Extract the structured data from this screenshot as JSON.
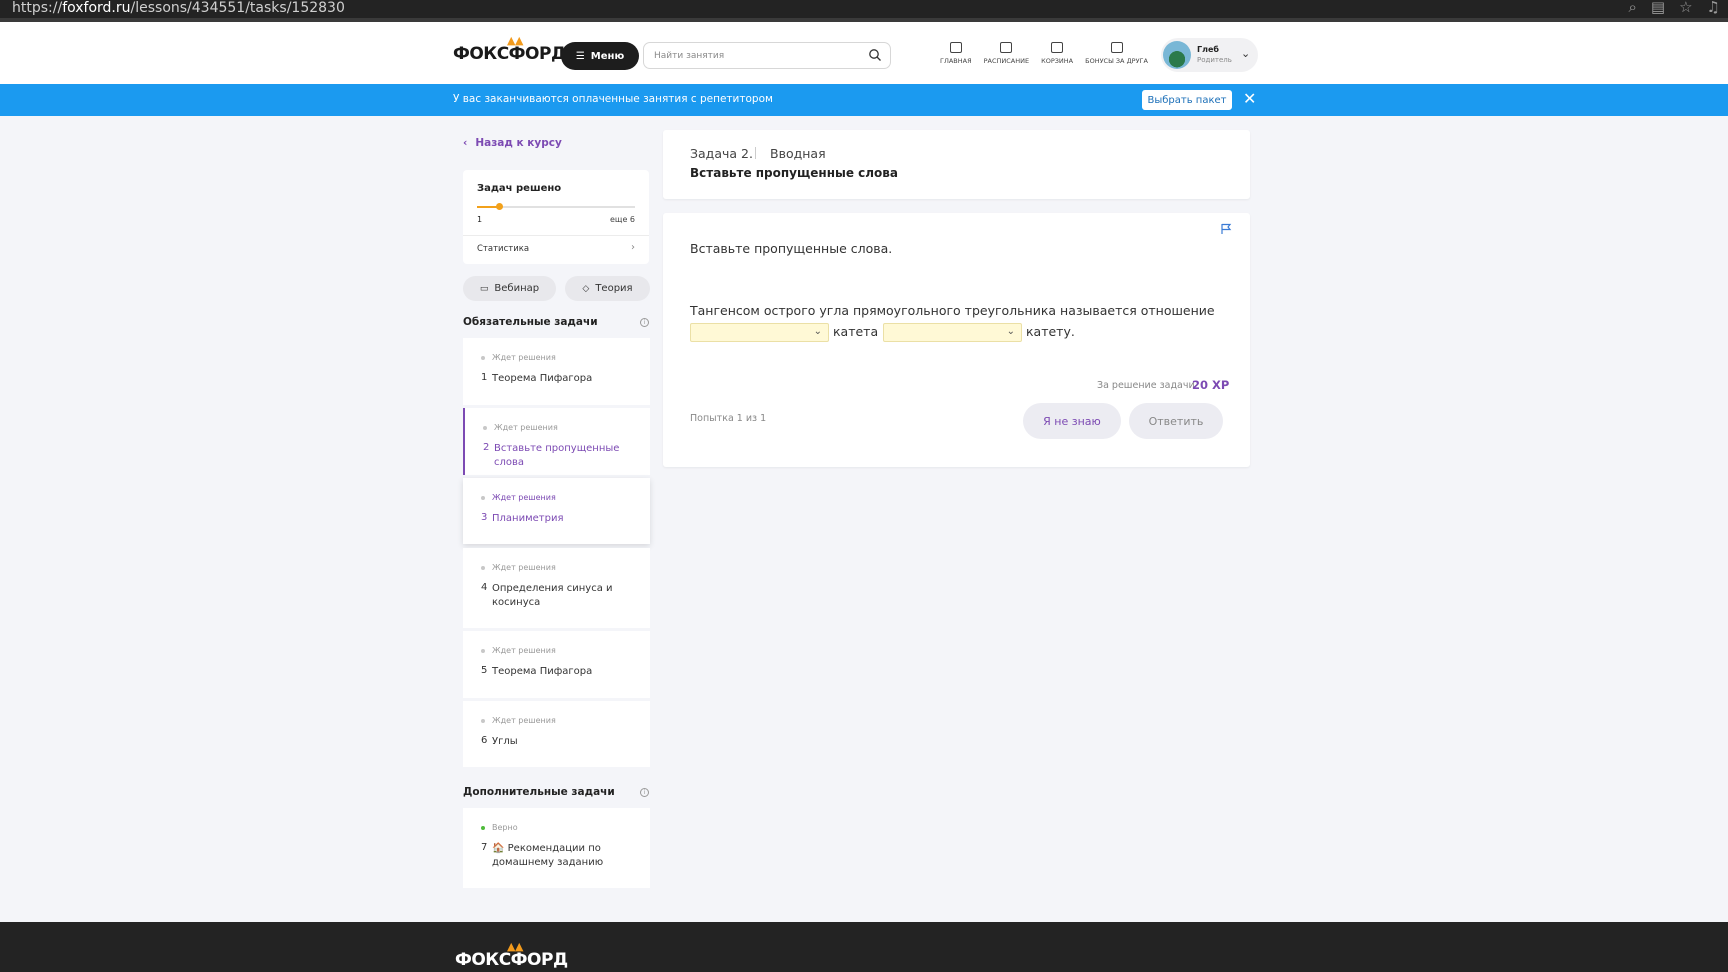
{
  "browser": {
    "url_prefix": "https://",
    "url_domain": "foxford.ru",
    "url_path": "/lessons/434551/tasks/152830"
  },
  "header": {
    "logo_text": "ФОКСФОРД",
    "menu_label": "Меню",
    "search_placeholder": "Найти занятия",
    "nav": [
      {
        "label": "ГЛАВНАЯ",
        "icon": "home-icon"
      },
      {
        "label": "РАСПИСАНИЕ",
        "icon": "calendar-icon"
      },
      {
        "label": "КОРЗИНА",
        "icon": "cart-icon"
      },
      {
        "label": "БОНУСЫ ЗА ДРУГА",
        "icon": "gift-icon"
      }
    ],
    "user": {
      "name": "Глеб",
      "role": "Родитель"
    }
  },
  "banner": {
    "text": "У вас заканчиваются оплаченные занятия с репетитором",
    "button": "Выбрать пакет"
  },
  "sidebar": {
    "back_label": "Назад к курсу",
    "progress": {
      "title": "Задач решено",
      "solved": "1",
      "remaining": "еще 6",
      "fraction": 0.14,
      "stats_label": "Статистика"
    },
    "webinar_label": "Вебинар",
    "theory_label": "Теория",
    "required_title": "Обязательные задачи",
    "required_tasks": [
      {
        "num": "1",
        "status": "Ждет решения",
        "label": "Теорема Пифагора"
      },
      {
        "num": "2",
        "status": "Ждет решения",
        "label": "Вставьте пропущенные слова"
      },
      {
        "num": "3",
        "status": "Ждет решения",
        "label": "Планиметрия"
      },
      {
        "num": "4",
        "status": "Ждет решения",
        "label": "Определения синуса и косинуса"
      },
      {
        "num": "5",
        "status": "Ждет решения",
        "label": "Теорема Пифагора"
      },
      {
        "num": "6",
        "status": "Ждет решения",
        "label": "Углы"
      }
    ],
    "extra_title": "Дополнительные задачи",
    "extra_tasks": [
      {
        "num": "7",
        "status": "Верно",
        "label": "🏠 Рекомендации по домашнему заданию"
      }
    ]
  },
  "main": {
    "task_no": "Задача 2.",
    "tag": "Вводная",
    "title": "Вставьте пропущенные слова",
    "instruction": "Вставьте пропущенные слова.",
    "sentence_start": "Тангенсом острого угла прямоугольного треугольника называется отношение",
    "sentence_mid": "катета к",
    "sentence_end": "катету.",
    "select1_value": "",
    "select2_value": "",
    "reward_label": "За решение задачи",
    "reward_value": "20 XP",
    "attempt": "Попытка 1 из 1",
    "dont_know_label": "Я не знаю",
    "answer_label": "Ответить"
  },
  "footer": {
    "logo_text": "ФОКСФОРД"
  }
}
